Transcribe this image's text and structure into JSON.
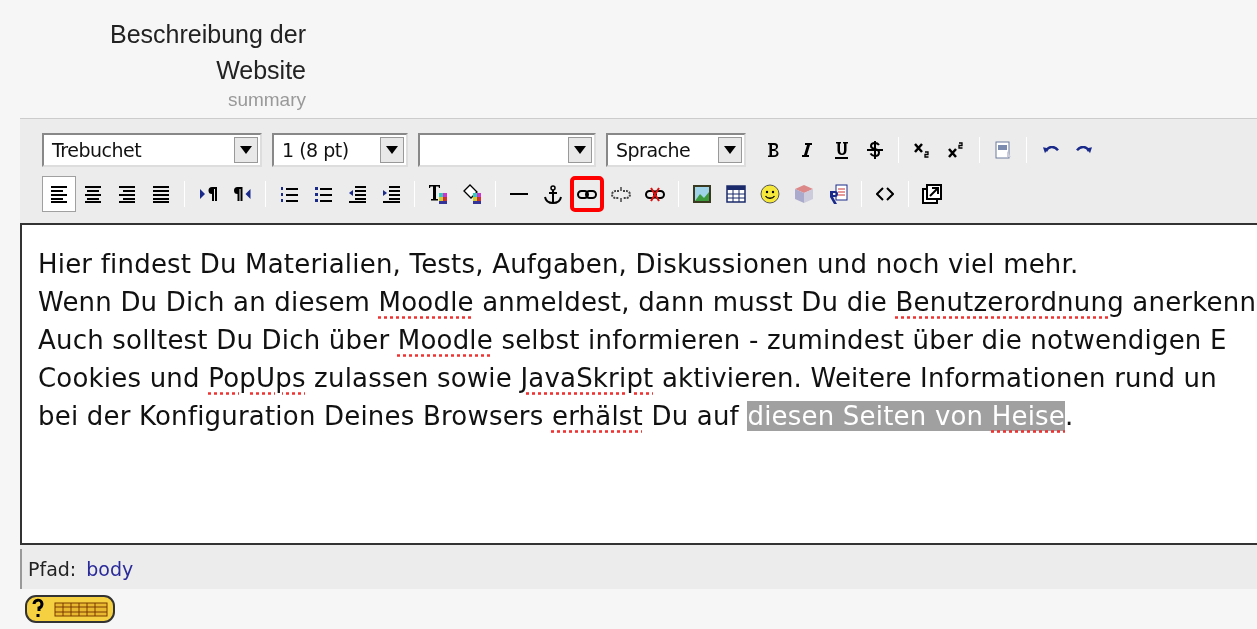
{
  "field_label": {
    "title_lines": [
      "Beschreibung der",
      "Website"
    ],
    "subtitle": "summary"
  },
  "toolbar": {
    "rows": [
      {
        "selects": [
          {
            "kind": "font",
            "value": "Trebuchet"
          },
          {
            "kind": "size",
            "value": "1 (8 pt)"
          },
          {
            "kind": "style"
          },
          {
            "kind": "language",
            "value": "Sprache"
          }
        ],
        "buttons": [
          {
            "kind": "bold",
            "selected": false,
            "marked": false
          },
          {
            "kind": "italic",
            "selected": false,
            "marked": false
          },
          {
            "kind": "underline",
            "selected": false,
            "marked": false
          },
          {
            "kind": "strike",
            "selected": false,
            "marked": false
          },
          {
            "kind": "separator"
          },
          {
            "kind": "subscript",
            "selected": false,
            "marked": false
          },
          {
            "kind": "superscript",
            "selected": false,
            "marked": false
          },
          {
            "kind": "separator"
          },
          {
            "kind": "clean-word",
            "selected": false,
            "marked": false
          },
          {
            "kind": "separator"
          },
          {
            "kind": "undo",
            "selected": false,
            "marked": false
          },
          {
            "kind": "redo",
            "selected": false,
            "marked": false
          }
        ]
      },
      {
        "buttons": [
          {
            "kind": "align-left",
            "selected": true,
            "marked": false
          },
          {
            "kind": "align-center",
            "selected": false,
            "marked": false
          },
          {
            "kind": "align-right",
            "selected": false,
            "marked": false
          },
          {
            "kind": "justify",
            "selected": false,
            "marked": false
          },
          {
            "kind": "separator"
          },
          {
            "kind": "ltr",
            "selected": false,
            "marked": false
          },
          {
            "kind": "rtl",
            "selected": false,
            "marked": false
          },
          {
            "kind": "separator"
          },
          {
            "kind": "ordered-list",
            "selected": false,
            "marked": false
          },
          {
            "kind": "bullet-list",
            "selected": false,
            "marked": false
          },
          {
            "kind": "outdent",
            "selected": false,
            "marked": false
          },
          {
            "kind": "indent",
            "selected": false,
            "marked": false
          },
          {
            "kind": "separator"
          },
          {
            "kind": "text-color",
            "selected": false,
            "marked": false
          },
          {
            "kind": "highlight-color",
            "selected": false,
            "marked": false
          },
          {
            "kind": "separator"
          },
          {
            "kind": "rule",
            "selected": false,
            "marked": false
          },
          {
            "kind": "anchor",
            "selected": false,
            "marked": false
          },
          {
            "kind": "link",
            "selected": false,
            "marked": true
          },
          {
            "kind": "unlink",
            "selected": false,
            "marked": false
          },
          {
            "kind": "nolink",
            "selected": false,
            "marked": false
          },
          {
            "kind": "separator"
          },
          {
            "kind": "image",
            "selected": false,
            "marked": false
          },
          {
            "kind": "table",
            "selected": false,
            "marked": false
          },
          {
            "kind": "smiley",
            "selected": false,
            "marked": false
          },
          {
            "kind": "special-char",
            "selected": false,
            "marked": false
          },
          {
            "kind": "search-replace",
            "selected": false,
            "marked": false
          },
          {
            "kind": "separator"
          },
          {
            "kind": "source",
            "selected": false,
            "marked": false
          },
          {
            "kind": "separator"
          },
          {
            "kind": "fullscreen",
            "selected": false,
            "marked": false
          }
        ]
      }
    ]
  },
  "editor": {
    "lines": [
      [
        {
          "text": "Hier findest Du Materialien, Tests, Aufgaben, Diskussionen und noch viel mehr.",
          "misspelled": false,
          "selected": false
        }
      ],
      [
        {
          "text": "Wenn Du Dich an diesem ",
          "misspelled": false,
          "selected": false
        },
        {
          "text": "Moodle",
          "misspelled": true,
          "selected": false
        },
        {
          "text": " anmeldest, dann musst Du die ",
          "misspelled": false,
          "selected": false
        },
        {
          "text": "Benutzerordnung",
          "misspelled": true,
          "selected": false
        },
        {
          "text": " anerkenn",
          "misspelled": false,
          "selected": false
        }
      ],
      [
        {
          "text": "Auch solltest Du Dich über ",
          "misspelled": false,
          "selected": false
        },
        {
          "text": "Moodle",
          "misspelled": true,
          "selected": false
        },
        {
          "text": " selbst informieren - zumindest über die notwendigen E",
          "misspelled": false,
          "selected": false
        }
      ],
      [
        {
          "text": "Cookies und ",
          "misspelled": false,
          "selected": false
        },
        {
          "text": "PopUps",
          "misspelled": true,
          "selected": false
        },
        {
          "text": " zulassen sowie ",
          "misspelled": false,
          "selected": false
        },
        {
          "text": "JavaSkript",
          "misspelled": true,
          "selected": false
        },
        {
          "text": " aktivieren. Weitere Informationen rund un",
          "misspelled": false,
          "selected": false
        }
      ],
      [
        {
          "text": "bei der Konfiguration Deines Browsers ",
          "misspelled": false,
          "selected": false
        },
        {
          "text": "erhälst",
          "misspelled": true,
          "selected": false
        },
        {
          "text": " Du auf ",
          "misspelled": false,
          "selected": false
        },
        {
          "text": "diesen Seiten von ",
          "misspelled": false,
          "selected": true
        },
        {
          "text": "Heise",
          "misspelled": true,
          "selected": true
        },
        {
          "text": ".",
          "misspelled": false,
          "selected": false
        }
      ]
    ]
  },
  "status_bar": {
    "label": "Pfad:",
    "path": "body"
  }
}
